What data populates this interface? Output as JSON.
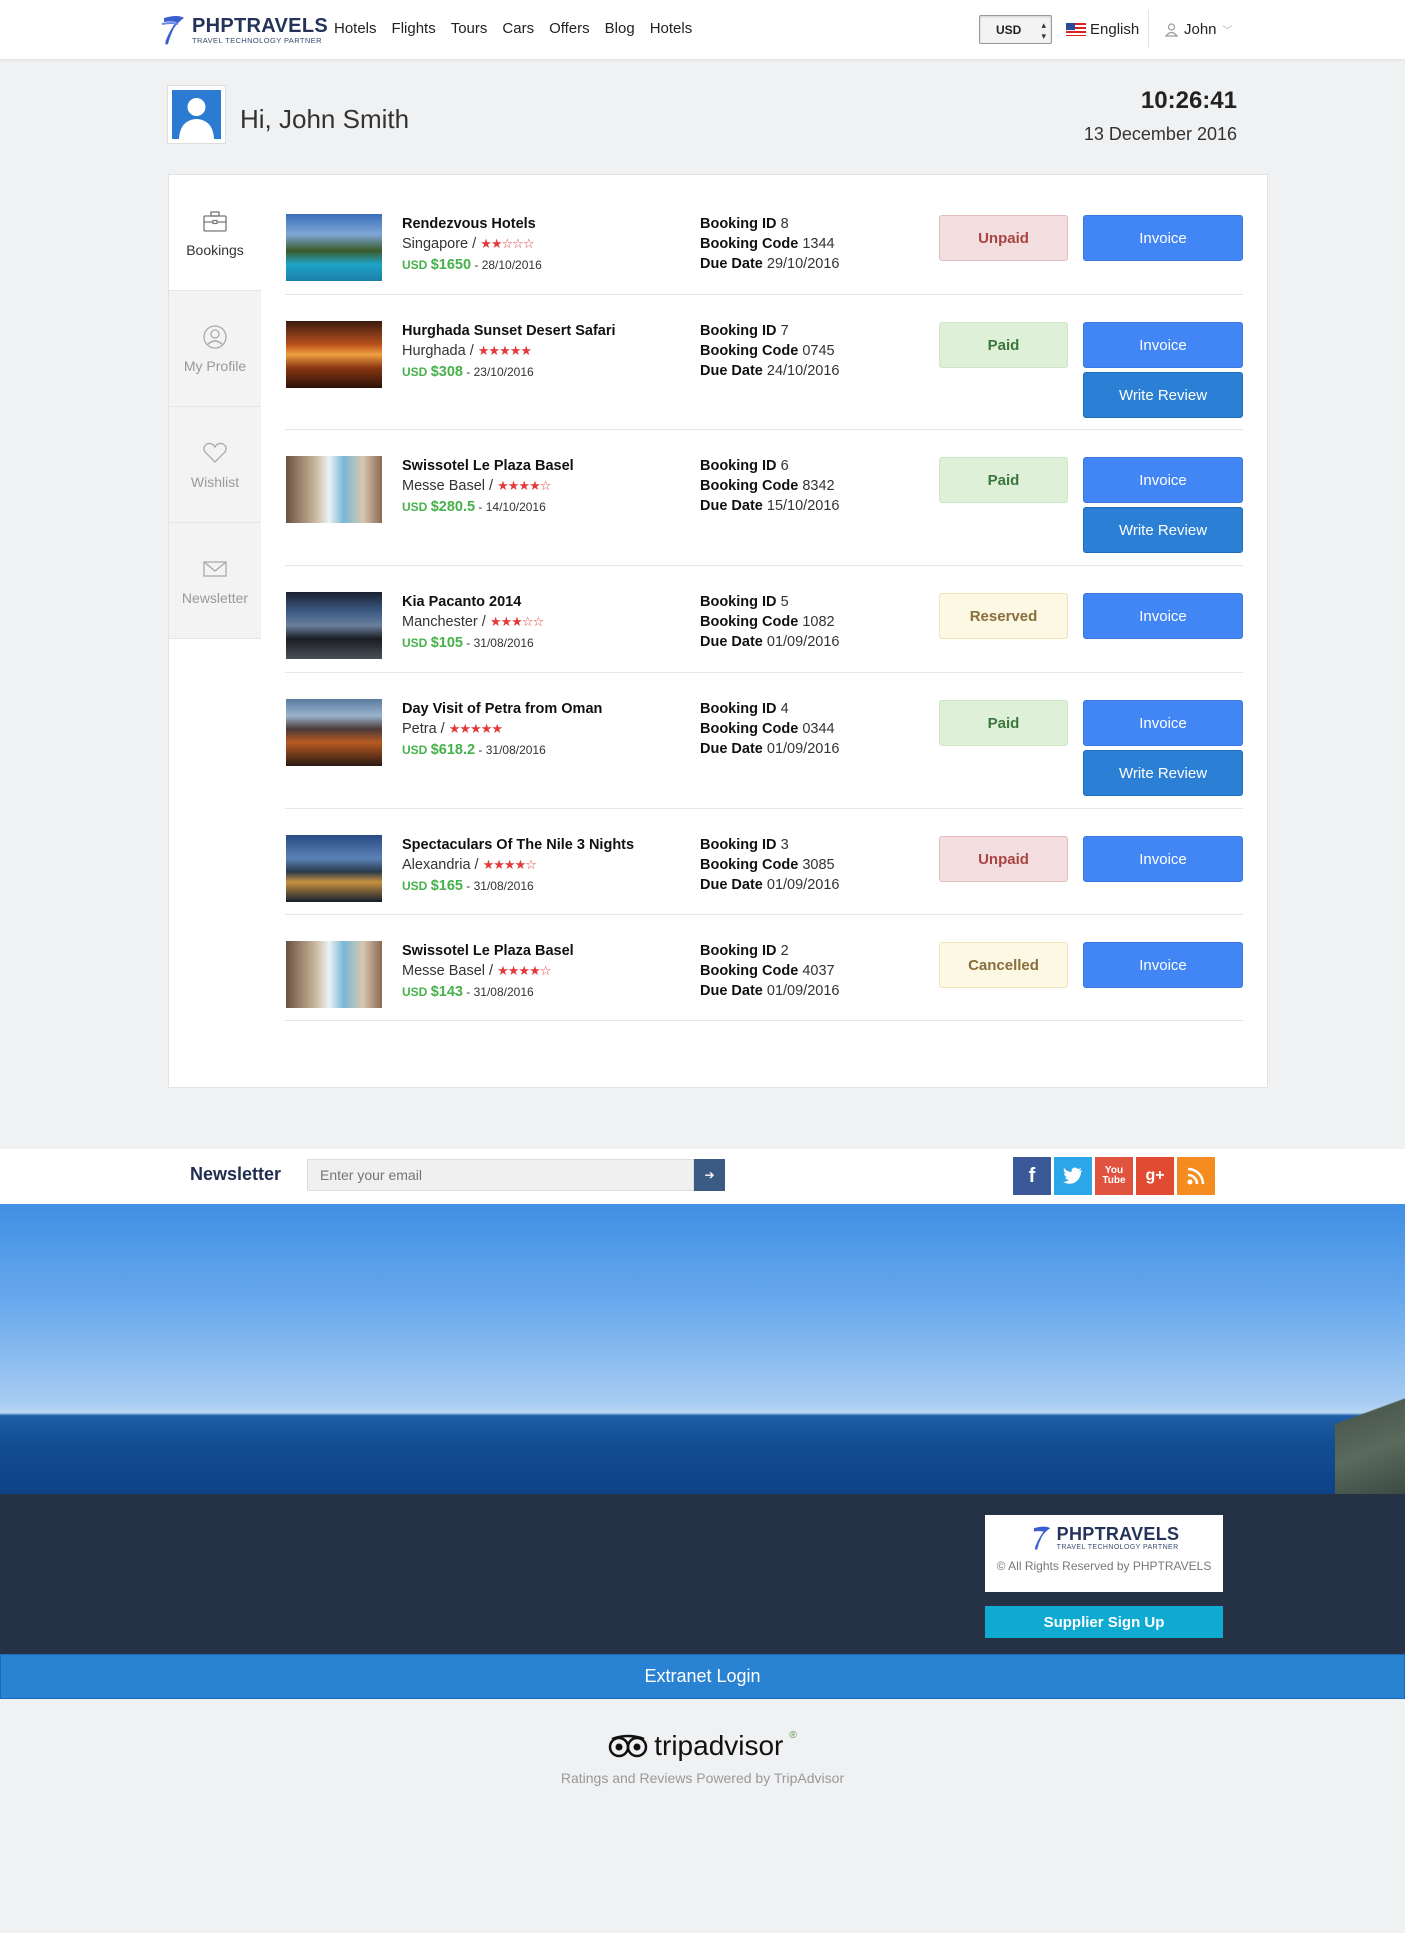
{
  "header": {
    "brand": "PHPTRAVELS",
    "tagline": "TRAVEL TECHNOLOGY PARTNER",
    "nav": [
      "Hotels",
      "Flights",
      "Tours",
      "Cars",
      "Offers",
      "Blog",
      "Hotels"
    ],
    "currency": "USD",
    "language": "English",
    "user": "John"
  },
  "greeting": {
    "text": "Hi, John Smith",
    "time": "10:26:41",
    "date": "13 December 2016"
  },
  "sidebar": {
    "tabs": [
      {
        "label": "Bookings",
        "icon": "briefcase-icon",
        "active": true
      },
      {
        "label": "My Profile",
        "icon": "user-circle-icon",
        "active": false
      },
      {
        "label": "Wishlist",
        "icon": "heart-icon",
        "active": false
      },
      {
        "label": "Newsletter",
        "icon": "envelope-icon",
        "active": false
      }
    ]
  },
  "bookings": [
    {
      "title": "Rendezvous Hotels",
      "location": "Singapore /",
      "stars": "★★☆☆☆",
      "price": "$1650",
      "currency_label": "USD",
      "date": "28/10/2016",
      "id_label": "Booking ID",
      "id": "8",
      "code_label": "Booking Code",
      "code": "1344",
      "due_label": "Due Date",
      "due": "29/10/2016",
      "status": "Unpaid",
      "invoice": "Invoice",
      "review": null
    },
    {
      "title": "Hurghada Sunset Desert Safari",
      "location": "Hurghada /",
      "stars": "★★★★★",
      "price": "$308",
      "currency_label": "USD",
      "date": "23/10/2016",
      "id_label": "Booking ID",
      "id": "7",
      "code_label": "Booking Code",
      "code": "0745",
      "due_label": "Due Date",
      "due": "24/10/2016",
      "status": "Paid",
      "invoice": "Invoice",
      "review": "Write Review"
    },
    {
      "title": "Swissotel Le Plaza Basel",
      "location": "Messe Basel /",
      "stars": "★★★★☆",
      "price": "$280.5",
      "currency_label": "USD",
      "date": "14/10/2016",
      "id_label": "Booking ID",
      "id": "6",
      "code_label": "Booking Code",
      "code": "8342",
      "due_label": "Due Date",
      "due": "15/10/2016",
      "status": "Paid",
      "invoice": "Invoice",
      "review": "Write Review"
    },
    {
      "title": "Kia Pacanto 2014",
      "location": "Manchester /",
      "stars": "★★★☆☆",
      "price": "$105",
      "currency_label": "USD",
      "date": "31/08/2016",
      "id_label": "Booking ID",
      "id": "5",
      "code_label": "Booking Code",
      "code": "1082",
      "due_label": "Due Date",
      "due": "01/09/2016",
      "status": "Reserved",
      "invoice": "Invoice",
      "review": null
    },
    {
      "title": "Day Visit of Petra from Oman",
      "location": "Petra /",
      "stars": "★★★★★",
      "price": "$618.2",
      "currency_label": "USD",
      "date": "31/08/2016",
      "id_label": "Booking ID",
      "id": "4",
      "code_label": "Booking Code",
      "code": "0344",
      "due_label": "Due Date",
      "due": "01/09/2016",
      "status": "Paid",
      "invoice": "Invoice",
      "review": "Write Review"
    },
    {
      "title": "Spectaculars Of The Nile 3 Nights",
      "location": "Alexandria /",
      "stars": "★★★★☆",
      "price": "$165",
      "currency_label": "USD",
      "date": "31/08/2016",
      "id_label": "Booking ID",
      "id": "3",
      "code_label": "Booking Code",
      "code": "3085",
      "due_label": "Due Date",
      "due": "01/09/2016",
      "status": "Unpaid",
      "invoice": "Invoice",
      "review": null
    },
    {
      "title": "Swissotel Le Plaza Basel",
      "location": "Messe Basel /",
      "stars": "★★★★☆",
      "price": "$143",
      "currency_label": "USD",
      "date": "31/08/2016",
      "id_label": "Booking ID",
      "id": "2",
      "code_label": "Booking Code",
      "code": "4037",
      "due_label": "Due Date",
      "due": "01/09/2016",
      "status": "Cancelled",
      "invoice": "Invoice",
      "review": null
    }
  ],
  "newsletter": {
    "label": "Newsletter",
    "placeholder": "Enter your email",
    "social": [
      "facebook-icon",
      "twitter-icon",
      "youtube-icon",
      "google-plus-icon",
      "rss-icon"
    ]
  },
  "footer": {
    "brand": "PHPTRAVELS",
    "tagline": "TRAVEL TECHNOLOGY PARTNER",
    "copyright": "© All Rights Reserved by PHPTRAVELS",
    "supplier": "Supplier Sign Up",
    "extranet": "Extranet Login",
    "tripadvisor": "tripadvisor",
    "tripadvisor_sub": "Ratings and Reviews Powered by TripAdvisor"
  },
  "colors": {
    "primary": "#4285f4",
    "review": "#2b7fd4",
    "price": "#46b04a",
    "star": "#e23a3a",
    "footer": "#253246",
    "supplier": "#0eaad2",
    "extranet": "#2a82d2"
  }
}
